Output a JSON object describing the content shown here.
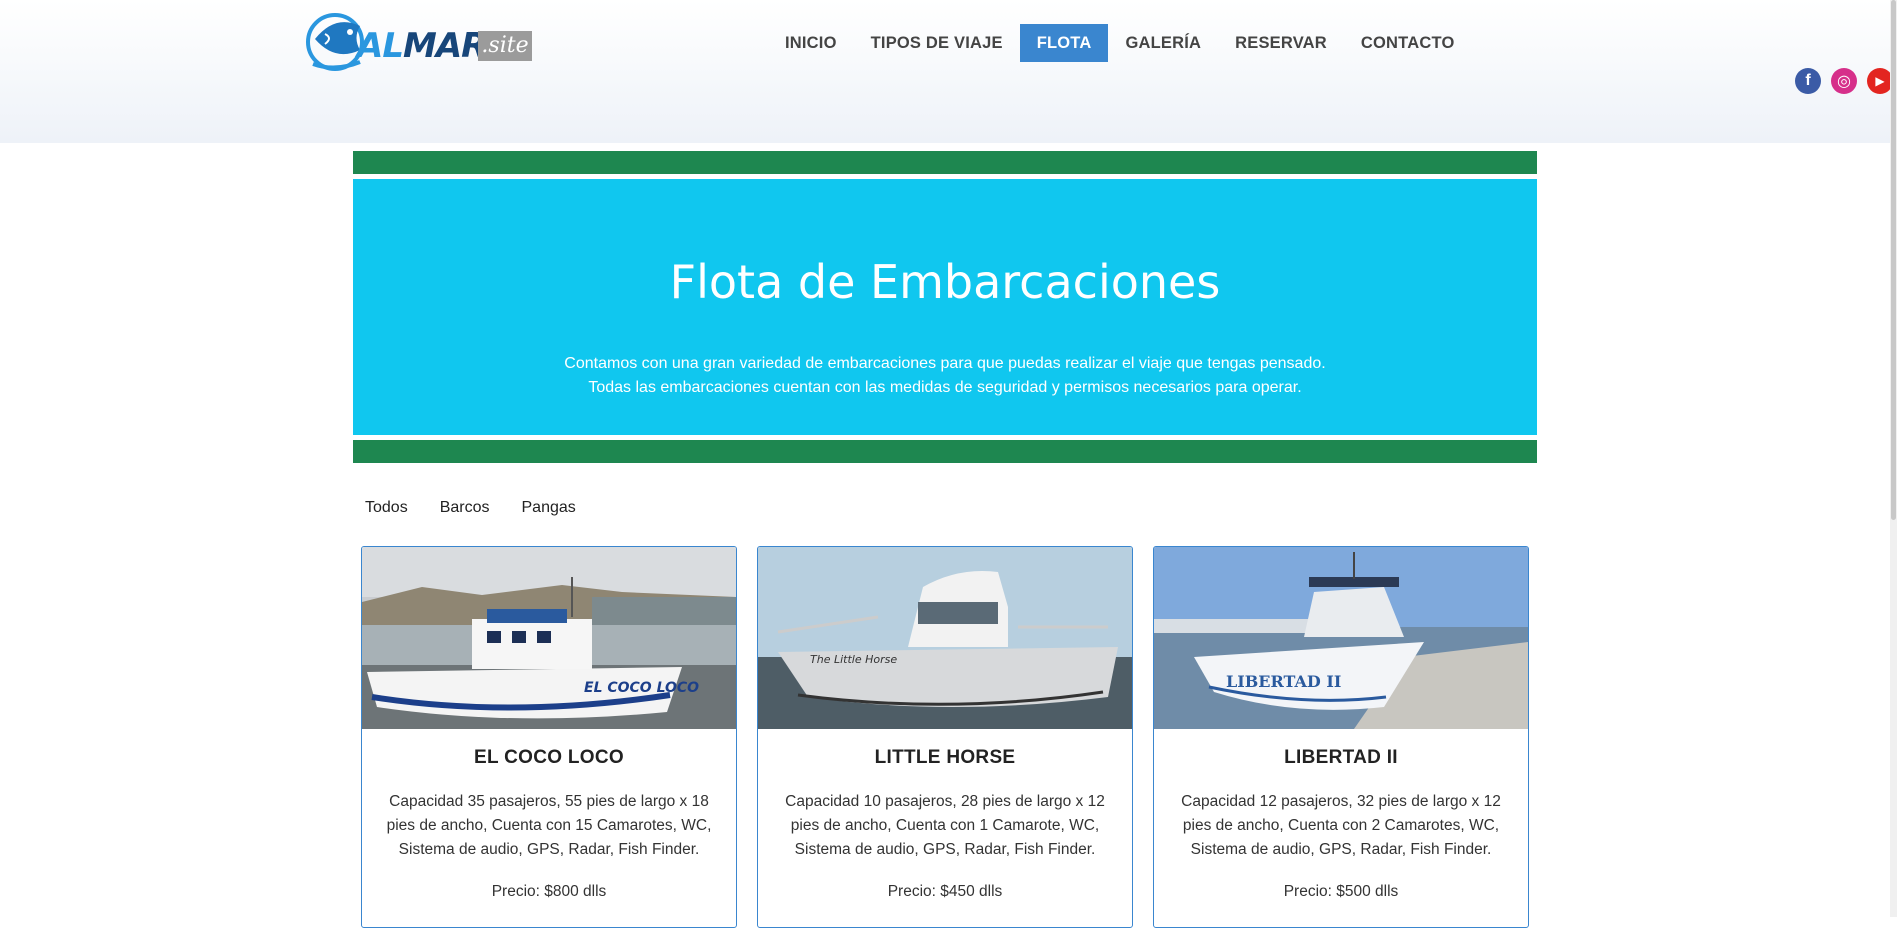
{
  "logo": {
    "brand_main": "ALMAR",
    "brand_tld": ".site"
  },
  "nav": {
    "items": [
      {
        "label": "INICIO"
      },
      {
        "label": "TIPOS DE VIAJE"
      },
      {
        "label": "FLOTA"
      },
      {
        "label": "GALERÍA"
      },
      {
        "label": "RESERVAR"
      },
      {
        "label": "CONTACTO"
      }
    ],
    "active": "FLOTA"
  },
  "social": {
    "facebook": "f",
    "instagram": "◎",
    "youtube": "▶"
  },
  "hero": {
    "title": "Flota de Embarcaciones",
    "line1": "Contamos con una gran variedad de embarcaciones para que puedas realizar el viaje que tengas pensado.",
    "line2": "Todas las embarcaciones cuentan con las medidas de seguridad y permisos necesarios para operar."
  },
  "filters": [
    {
      "label": "Todos"
    },
    {
      "label": "Barcos"
    },
    {
      "label": "Pangas"
    }
  ],
  "boats": [
    {
      "name": "EL COCO LOCO",
      "hull_text": "EL COCO LOCO",
      "desc": "Capacidad 35 pasajeros, 55 pies de largo x 18 pies de ancho, Cuenta con 15 Camarotes, WC, Sistema de audio, GPS, Radar, Fish Finder.",
      "price": "Precio: $800 dlls"
    },
    {
      "name": "LITTLE HORSE",
      "hull_text": "The Little Horse",
      "desc": "Capacidad 10 pasajeros, 28 pies de largo x 12 pies de ancho, Cuenta con 1 Camarote, WC, Sistema de audio, GPS, Radar, Fish Finder.",
      "price": "Precio: $450 dlls"
    },
    {
      "name": "LIBERTAD II",
      "hull_text": "LIBERTAD II",
      "desc": "Capacidad 12 pasajeros, 32 pies de largo x 12 pies de ancho, Cuenta con 2 Camarotes, WC, Sistema de audio, GPS, Radar, Fish Finder.",
      "price": "Precio: $500 dlls"
    }
  ],
  "colors": {
    "nav_active": "#3a86cf",
    "hero_bg": "#10c7ef",
    "band": "#1e8750",
    "card_border": "#3a86cf"
  }
}
